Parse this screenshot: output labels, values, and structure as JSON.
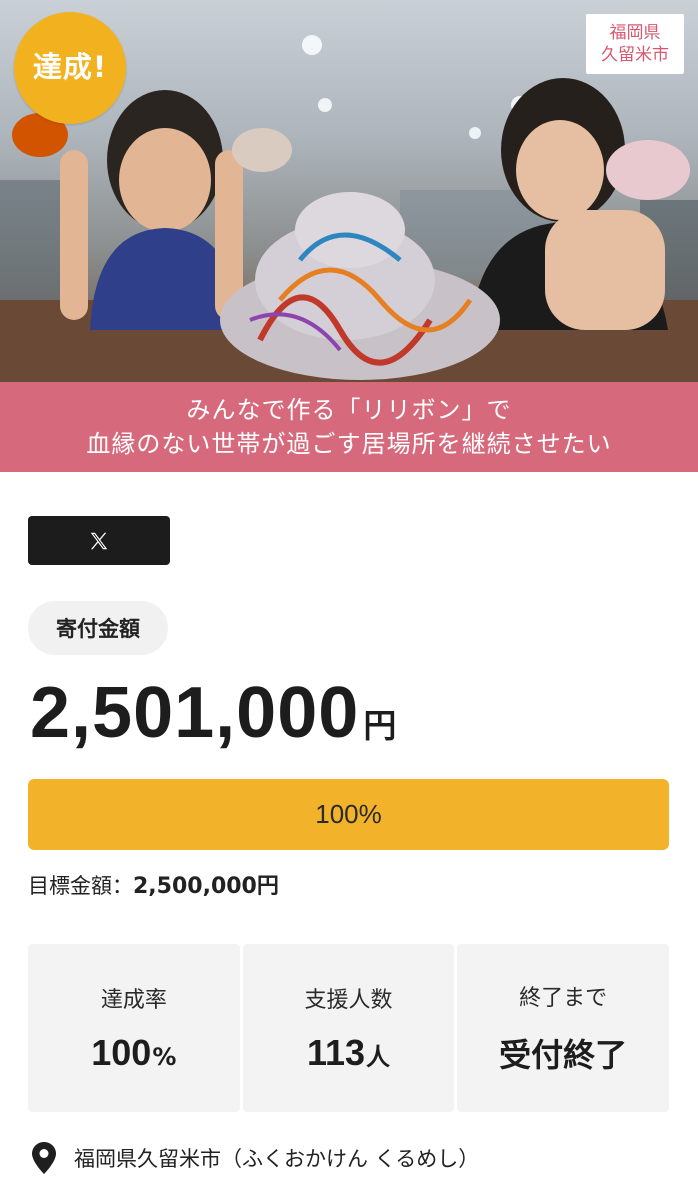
{
  "hero": {
    "badge": "達成!",
    "region_line1": "福岡県",
    "region_line2": "久留米市",
    "caption_line1": "みんなで作る「リリボン」で",
    "caption_line2": "血縁のない世帯が過ごす居場所を継続させたい"
  },
  "share": {
    "x_label": "𝕏"
  },
  "donation": {
    "label": "寄付金額",
    "amount": "2,501,000",
    "unit": "円",
    "progress_percent": 100,
    "progress_text": "100%",
    "goal_label": "目標金額：",
    "goal_value": "2,500,000円"
  },
  "stats": [
    {
      "label": "達成率",
      "value": "100",
      "unit": "%"
    },
    {
      "label": "支援人数",
      "value": "113",
      "unit": "人"
    },
    {
      "label": "終了まで",
      "value": "受付終了",
      "unit": ""
    }
  ],
  "location": {
    "text": "福岡県久留米市（ふくおかけん くるめし）"
  },
  "colors": {
    "accent": "#f2b22a",
    "caption_bg": "#d66a7c",
    "region_text": "#d8576f"
  }
}
